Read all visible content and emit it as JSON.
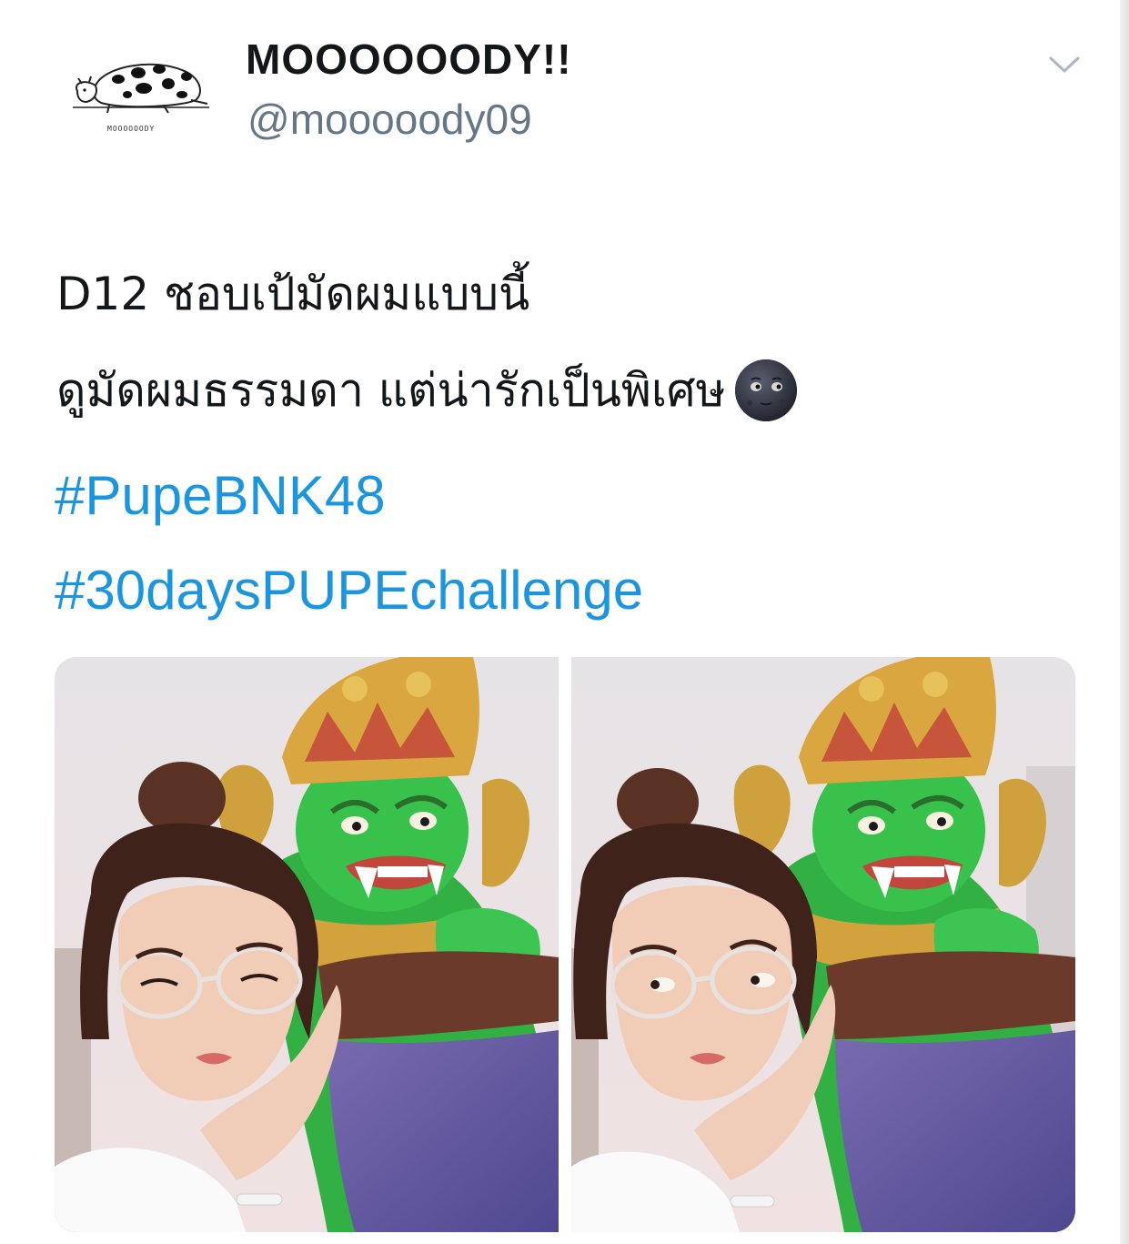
{
  "tweet": {
    "author": {
      "display_name": "MOOOOOODY!!",
      "handle": "@mooooody09",
      "avatar_caption": "MOOOOOODY",
      "avatar_icon": "cow-icon"
    },
    "menu_icon": "chevron-down-icon",
    "text_line_1": "D12 ชอบเป้มัดผมแบบนี้",
    "text_line_2": "ดูมัดผมธรรมดา แต่น่ารักเป็นพิเศษ",
    "emoji": "new-moon-face-icon",
    "hashtags": [
      "#PupeBNK48",
      "#30daysPUPEchallenge"
    ],
    "media": [
      {
        "description_icon": "photo-icon"
      },
      {
        "description_icon": "photo-icon"
      }
    ]
  },
  "colors": {
    "link": "#1b95e0",
    "text": "#14171a",
    "secondary": "#657786"
  }
}
